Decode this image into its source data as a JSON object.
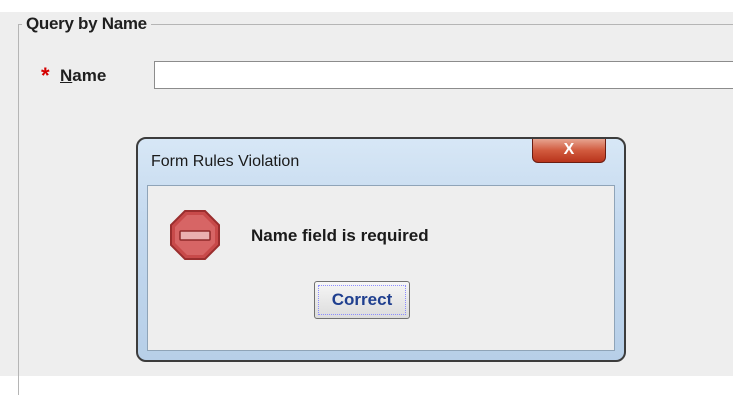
{
  "group": {
    "title": "Query by Name"
  },
  "form": {
    "required_marker": "*",
    "name_label_mnemonic": "N",
    "name_label_rest": "ame",
    "name_value": ""
  },
  "dialog": {
    "title": "Form Rules Violation",
    "close_label": "X",
    "message": "Name field is required",
    "correct_label": "Correct"
  },
  "colors": {
    "required": "#d40000",
    "close_button": "#d15a3e",
    "stop_icon": "#c84a4a"
  },
  "icons": {
    "error": "stop-sign-icon",
    "close": "close-icon"
  }
}
